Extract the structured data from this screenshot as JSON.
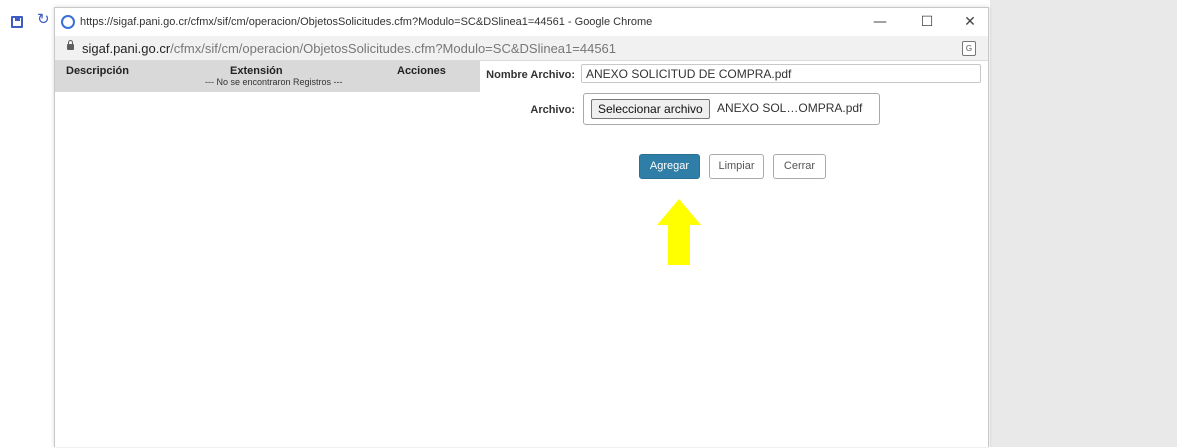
{
  "window": {
    "title": "https://sigaf.pani.go.cr/cfmx/sif/cm/operacion/ObjetosSolicitudes.cfm?Modulo=SC&DSlinea1=44561 - Google Chrome",
    "controls": {
      "minimize": "—",
      "maximize": "☐",
      "close": "✕"
    }
  },
  "address": {
    "host": "sigaf.pani.go.cr",
    "path": "/cfmx/sif/cm/operacion/ObjetosSolicitudes.cfm?Modulo=SC&DSlinea1=44561"
  },
  "grid": {
    "columns": [
      "Descripción",
      "Extensión",
      "Acciones"
    ],
    "empty_message": "--- No se encontraron Registros ---"
  },
  "form": {
    "nombre_label": "Nombre Archivo:",
    "nombre_value": "ANEXO SOLICITUD DE COMPRA.pdf",
    "archivo_label": "Archivo:",
    "file_button": "Seleccionar archivo",
    "file_name": "ANEXO SOL…OMPRA.pdf"
  },
  "buttons": {
    "agregar": "Agregar",
    "limpiar": "Limpiar",
    "cerrar": "Cerrar"
  },
  "colors": {
    "accent": "#2f7ea7",
    "arrow": "#ffff00"
  },
  "icons": {
    "background_app": [
      "save-icon",
      "refresh-icon"
    ],
    "window": "chrome-icon",
    "address": [
      "lock-icon",
      "translate-icon"
    ]
  }
}
